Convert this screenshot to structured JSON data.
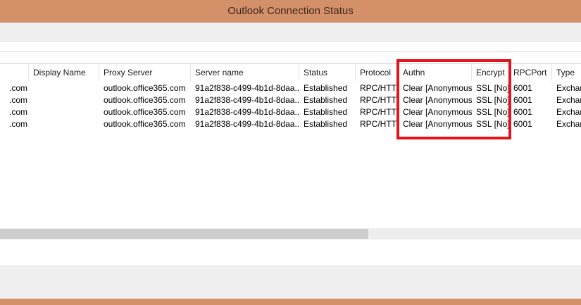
{
  "window": {
    "title": "Outlook Connection Status"
  },
  "table": {
    "columns": [
      "",
      "Display Name",
      "Proxy Server",
      "Server name",
      "Status",
      "Protocol",
      "Authn",
      "Encrypt",
      "RPCPort",
      "Type"
    ],
    "rows": [
      [
        ".com",
        "",
        "outlook.office365.com",
        "91a2f838-c499-4b1d-8daa...",
        "Established",
        "RPC/HTTP",
        "Clear [Anonymous]",
        "SSL [No]",
        "6001",
        "Exchan"
      ],
      [
        ".com",
        "",
        "outlook.office365.com",
        "91a2f838-c499-4b1d-8daa...",
        "Established",
        "RPC/HTTP",
        "Clear [Anonymous]",
        "SSL [No]",
        "6001",
        "Exchan"
      ],
      [
        ".com",
        "",
        "outlook.office365.com",
        "91a2f838-c499-4b1d-8daa...",
        "Established",
        "RPC/HTTP",
        "Clear [Anonymous]",
        "SSL [No]",
        "6001",
        "Exchan"
      ],
      [
        ".com",
        "",
        "outlook.office365.com",
        "91a2f838-c499-4b1d-8daa...",
        "Established",
        "RPC/HTTP",
        "Clear [Anonymous]",
        "SSL [No]",
        "6001",
        "Exchan"
      ]
    ]
  },
  "colors": {
    "titlebar": "#d49068",
    "highlight": "#e0161f"
  }
}
